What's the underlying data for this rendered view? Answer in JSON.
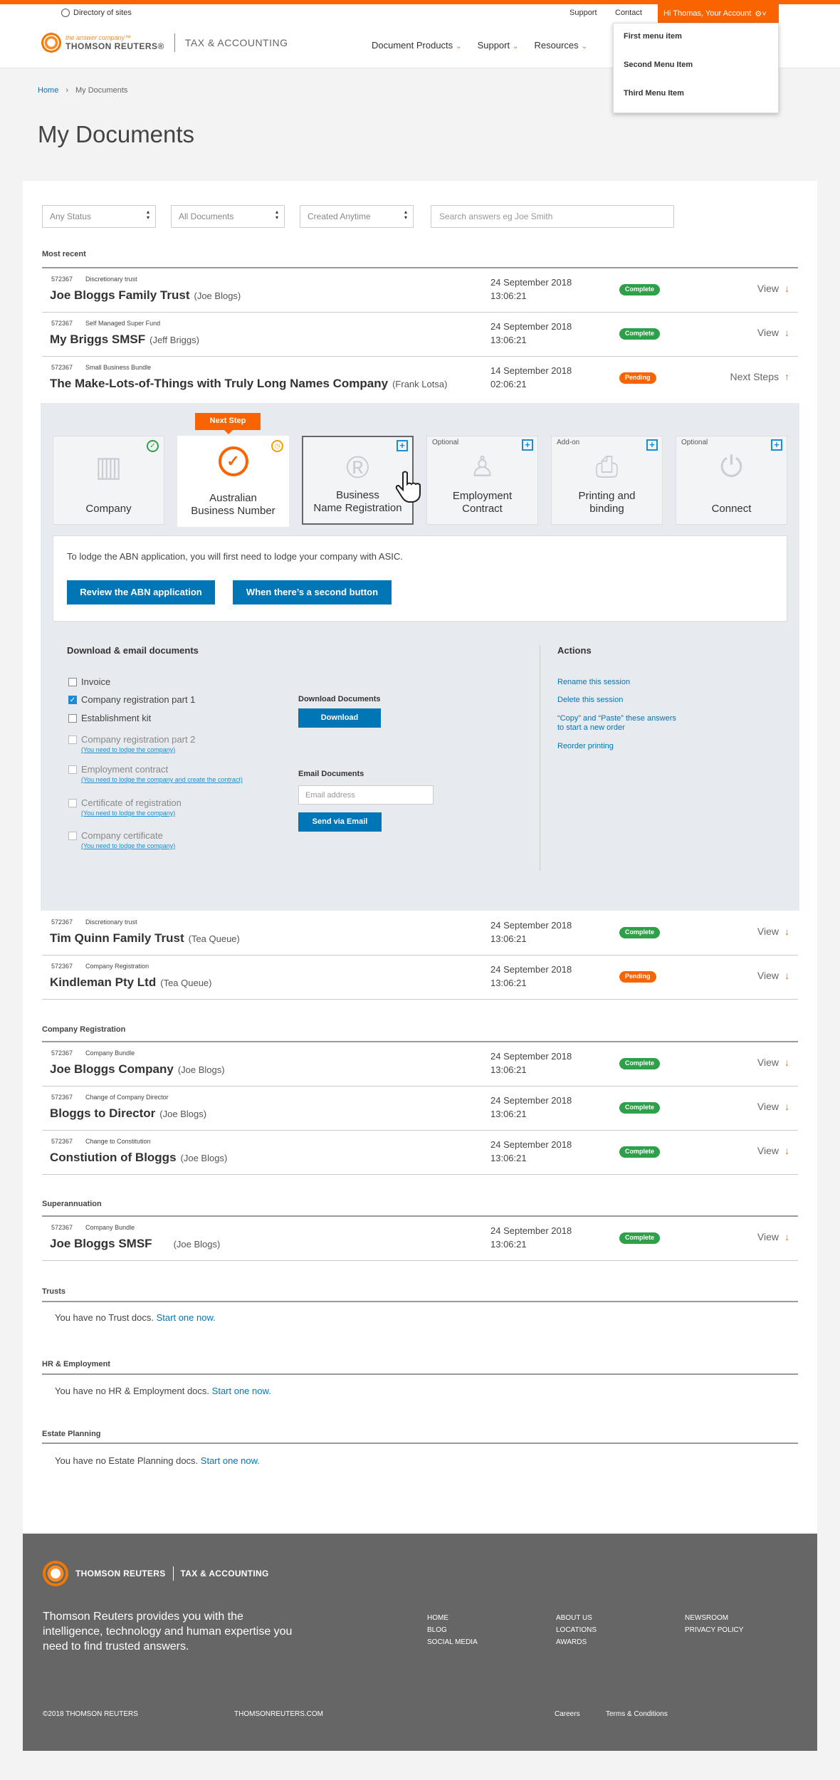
{
  "utility": {
    "directory": "Directory of sites",
    "support": "Support",
    "contact": "Contact",
    "account": "Hi Thomas, Your Account"
  },
  "account_menu": [
    "First menu item",
    "Second Menu Item",
    "Third Menu Item"
  ],
  "brand": {
    "tagline": "the answer company™",
    "name": "THOMSON REUTERS®",
    "division": "TAX & ACCOUNTING"
  },
  "nav": [
    "Document Products",
    "Support",
    "Resources"
  ],
  "breadcrumb": {
    "home": "Home",
    "current": "My Documents"
  },
  "page_title": "My Documents",
  "filters": {
    "status": "Any Status",
    "documents": "All Documents",
    "created": "Created Anytime",
    "search_placeholder": "Search answers eg Joe Smith"
  },
  "sections": {
    "most_recent": "Most recent",
    "company_registration": "Company Registration",
    "superannuation": "Superannuation",
    "trusts": "Trusts",
    "hr": "HR & Employment",
    "estate": "Estate Planning"
  },
  "rows": [
    {
      "id": "572367",
      "type": "Discretionary trust",
      "name": "Joe Bloggs Family Trust",
      "who": "(Joe Blogs)",
      "date": "24 September 2018",
      "time": "13:06:21",
      "status": "Complete",
      "action": "View",
      "arrow": "↓"
    },
    {
      "id": "572367",
      "type": "Self Managed Super Fund",
      "name": "My Briggs SMSF",
      "who": "(Jeff Briggs)",
      "date": "24 September 2018",
      "time": "13:06:21",
      "status": "Complete",
      "action": "View",
      "arrow": "↓"
    },
    {
      "id": "572367",
      "type": "Small Business Bundle",
      "name": "The Make-Lots-of-Things with Truly Long Names Company",
      "who": "(Frank Lotsa)",
      "date": "14 September 2018",
      "time": "02:06:21",
      "status": "Pending",
      "action": "Next Steps",
      "arrow": "↑"
    },
    {
      "id": "572367",
      "type": "Discretionary trust",
      "name": "Tim Quinn Family Trust",
      "who": "(Tea Queue)",
      "date": "24 September 2018",
      "time": "13:06:21",
      "status": "Complete",
      "action": "View",
      "arrow": "↓"
    },
    {
      "id": "572367",
      "type": "Company Registration",
      "name": "Kindleman Pty Ltd",
      "who": "(Tea Queue)",
      "date": "24 September 2018",
      "time": "13:06:21",
      "status": "Pending",
      "action": "View",
      "arrow": "↓"
    },
    {
      "id": "572367",
      "type": "Company Bundle",
      "name": "Joe Bloggs Company",
      "who": "(Joe Blogs)",
      "date": "24 September 2018",
      "time": "13:06:21",
      "status": "Complete",
      "action": "View",
      "arrow": "↓"
    },
    {
      "id": "572367",
      "type": "Change of Company Director",
      "name": "Bloggs to Director",
      "who": "(Joe Blogs)",
      "date": "24 September 2018",
      "time": "13:06:21",
      "status": "Complete",
      "action": "View",
      "arrow": "↓"
    },
    {
      "id": "572367",
      "type": "Change to Constitution",
      "name": "Constiution of Bloggs",
      "who": "(Joe Blogs)",
      "date": "24 September 2018",
      "time": "13:06:21",
      "status": "Complete",
      "action": "View",
      "arrow": "↓"
    },
    {
      "id": "572367",
      "type": "Company Bundle",
      "name": "Joe Bloggs SMSF",
      "who": "(Joe Blogs)",
      "date": "24 September 2018",
      "time": "13:06:21",
      "status": "Complete",
      "action": "View",
      "arrow": "↓"
    }
  ],
  "steps": {
    "next_step_label": "Next Step",
    "company": "Company",
    "abn_1": "Australian",
    "abn_2": "Business Number",
    "bnr_1": "Business",
    "bnr_2": "Name Registration",
    "emp_opt": "Optional",
    "emp_1": "Employment",
    "emp_2": "Contract",
    "print_opt": "Add-on",
    "print_1": "Printing and",
    "print_2": "binding",
    "connect_opt": "Optional",
    "connect": "Connect"
  },
  "info": {
    "text": "To lodge the ABN application, you will first need to lodge your company with ASIC.",
    "btn1": "Review the ABN application",
    "btn2": "When there’s a second button"
  },
  "downloads": {
    "title": "Download & email documents",
    "items": [
      {
        "label": "Invoice",
        "checked": false
      },
      {
        "label": "Company registration part 1",
        "checked": true
      },
      {
        "label": "Establishment kit",
        "checked": false
      },
      {
        "label": "Company registration part 2",
        "note": "(You need to lodge the company)"
      },
      {
        "label": "Employment contract",
        "note_a": "(You need to lodge the company",
        "note_and": " and ",
        "note_b": "create the contract)"
      },
      {
        "label": "Certificate of registration",
        "note": "(You need to lodge the company)"
      },
      {
        "label": "Company certificate",
        "note": "(You need to lodge the company)"
      }
    ],
    "download_title": "Download Documents",
    "download_btn": "Download",
    "email_title": "Email Documents",
    "email_placeholder": "Email address",
    "email_btn": "Send via Email"
  },
  "actions": {
    "title": "Actions",
    "links": [
      "Rename this session",
      "Delete this session",
      "“Copy” and “Paste” these answers",
      "to start a new order",
      "Reorder printing"
    ]
  },
  "empty": {
    "trusts": "You have no Trust docs.",
    "hr": "You have no HR & Employment docs.",
    "estate": "You have no Estate Planning docs.",
    "start": "Start one now."
  },
  "footer": {
    "name": "THOMSON REUTERS",
    "division": "TAX & ACCOUNTING",
    "text": "Thomson Reuters provides you with the intelligence, technology and human expertise you need to find trusted answers.",
    "col1": [
      "HOME",
      "BLOG",
      "SOCIAL MEDIA"
    ],
    "col2": [
      "ABOUT US",
      "LOCATIONS",
      "AWARDS"
    ],
    "col3": [
      "NEWSROOM",
      "PRIVACY POLICY"
    ],
    "copyright": "©2018 THOMSON REUTERS",
    "site": "THOMSONREUTERS.COM",
    "careers": "Careers",
    "terms": "Terms & Conditions"
  },
  "colors": {
    "accent": "#fa6400",
    "link": "#0076b6",
    "complete": "#2fa04a",
    "pending": "#fa6400"
  }
}
